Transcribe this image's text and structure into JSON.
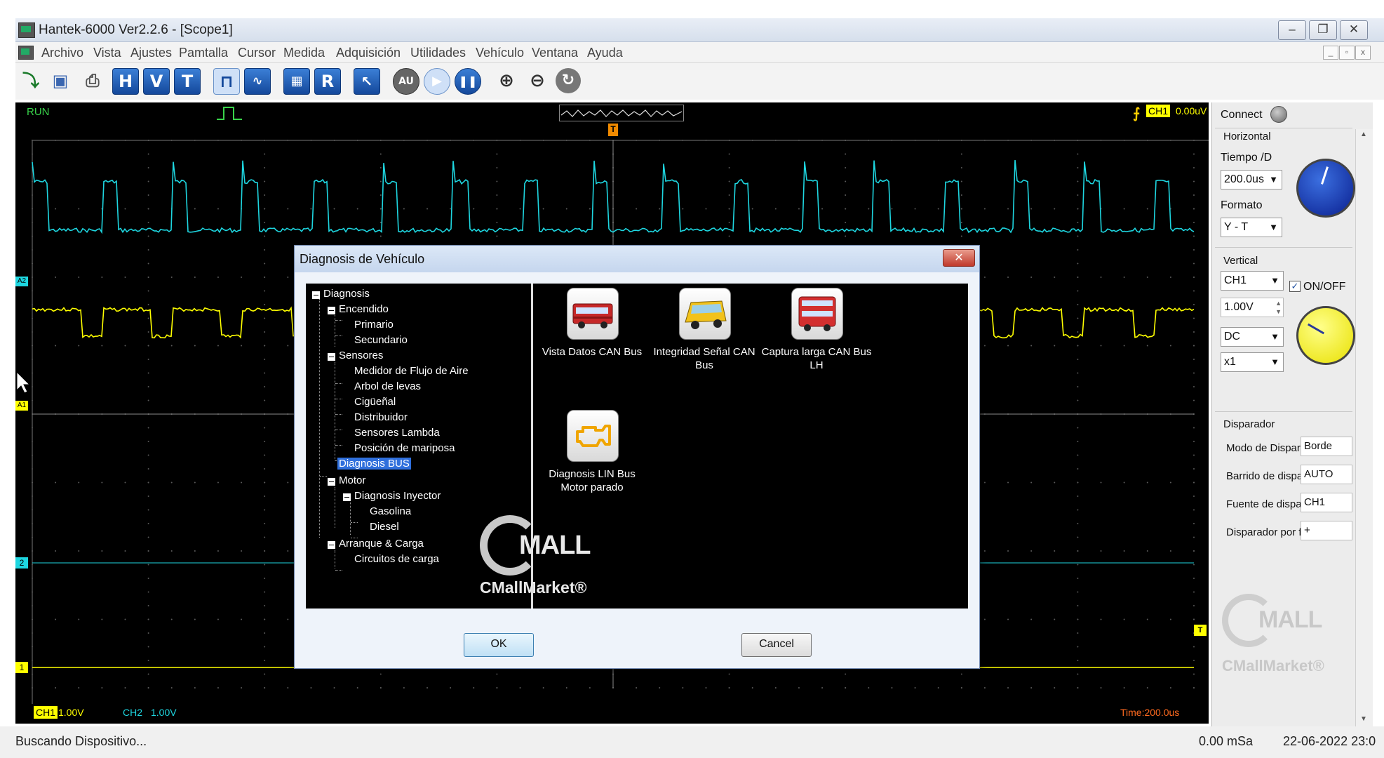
{
  "window": {
    "title": "Hantek-6000 Ver2.2.6 - [Scope1]",
    "controls": [
      "–",
      "❐",
      "✕"
    ],
    "mdi_controls": [
      "_",
      "▫",
      "x"
    ]
  },
  "menu": [
    "Archivo",
    "Vista",
    "Ajustes",
    "Pamtalla",
    "Cursor",
    "Medida",
    "Adquisición",
    "Utilidades",
    "Vehículo",
    "Ventana",
    "Ayuda"
  ],
  "toolbar": {
    "h": "H",
    "v": "V",
    "t": "T",
    "r": "R",
    "auto": "AU"
  },
  "scope": {
    "run_state": "RUN",
    "trigger_marker": "T",
    "trigger_tag": "CH1",
    "trigger_level": "0.00uV",
    "ch_markers": {
      "a2": "A2",
      "a1": "A1",
      "c2": "2",
      "c1": "1"
    },
    "ch1_scale_tag": "CH1",
    "ch1_scale": "1.00V",
    "ch2_scale_tag": "CH2",
    "ch2_scale": "1.00V",
    "time_div": "Time:200.0us",
    "colors": {
      "ch1": "#ffff00",
      "ch2": "#1ed6e0",
      "grid": "#5a5a5a"
    }
  },
  "panel": {
    "connect_label": "Connect",
    "horizontal_title": "Horizontal",
    "tiempo_label": "Tiempo /D",
    "tiempo_value": "200.0us",
    "formato_label": "Formato",
    "formato_value": "Y - T",
    "vertical_title": "Vertical",
    "channel_value": "CH1",
    "onoff_label": "ON/OFF",
    "volt_value": "1.00V",
    "coupling_value": "DC",
    "probe_value": "x1",
    "disparador_title": "Disparador",
    "trig_rows": [
      {
        "label": "Modo de Dispar:",
        "value": "Borde"
      },
      {
        "label": "Barrido de dispa",
        "value": "AUTO"
      },
      {
        "label": "Fuente de dispa",
        "value": "CH1"
      },
      {
        "label": "Disparador por fl",
        "value": "+"
      }
    ],
    "watermark_logo": "MALL",
    "watermark_text": "CMallMarket®"
  },
  "dialog": {
    "title": "Diagnosis de Vehículo",
    "tree": {
      "root": "Diagnosis",
      "encendido": "Encendido",
      "primario": "Primario",
      "secundario": "Secundario",
      "sensores": "Sensores",
      "flujo_aire": "Medidor de Flujo de Aire",
      "arbol_levas": "Arbol de levas",
      "ciguenal": "Cigüeñal",
      "distribuidor": "Distribuidor",
      "lambda": "Sensores Lambda",
      "mariposa": "Posición de mariposa",
      "diag_bus": "Diagnosis BUS",
      "motor": "Motor",
      "inyector": "Diagnosis Inyector",
      "gasolina": "Gasolina",
      "diesel": "Diesel",
      "arranque": "Arranque & Carga",
      "circuitos": "Circuitos de carga"
    },
    "tiles": [
      {
        "label": "Vista Datos CAN Bus",
        "icon": "red-bus-icon"
      },
      {
        "label": "Integridad Señal CAN Bus",
        "icon": "yellow-bus-icon"
      },
      {
        "label": "Captura larga CAN Bus LH",
        "icon": "double-decker-bus-icon"
      },
      {
        "label": "Diagnosis LIN Bus Motor parado",
        "icon": "engine-check-icon"
      }
    ],
    "watermark_logo": "MALL",
    "watermark_text": "CMallMarket®",
    "ok_label": "OK",
    "cancel_label": "Cancel"
  },
  "status": {
    "message": "Buscando Dispositivo...",
    "sample_rate": "0.00 mSa",
    "datetime": "22-06-2022 23:0"
  }
}
